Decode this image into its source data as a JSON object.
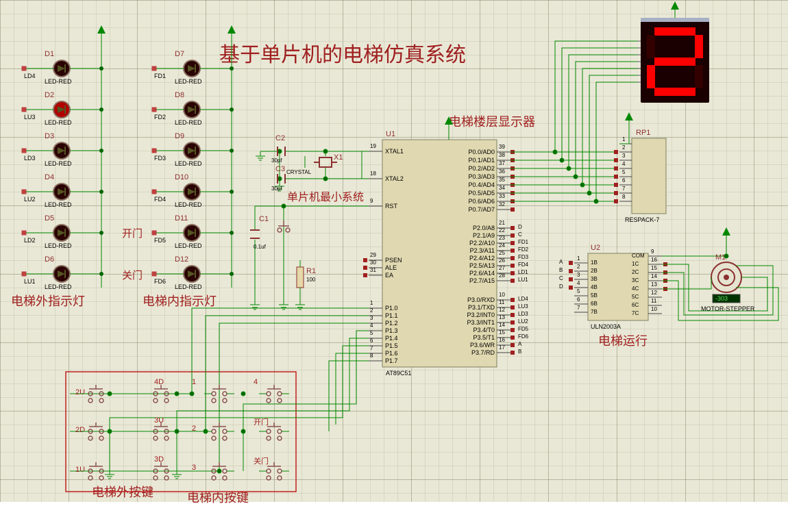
{
  "title": "基于单片机的电梯仿真系统",
  "sections": {
    "ext_leds": "电梯外指示灯",
    "int_leds": "电梯内指示灯",
    "ext_btns": "电梯外按键",
    "int_btns": "电梯内按键",
    "min_sys": "单片机最小系统",
    "floor_disp": "电梯楼层显示器",
    "motor_run": "电梯运行",
    "open": "开门",
    "close": "关门"
  },
  "leds_ext": [
    {
      "ref": "D1",
      "name": "LD4",
      "type": "LED-RED"
    },
    {
      "ref": "D2",
      "name": "LU3",
      "type": "LED-RED"
    },
    {
      "ref": "D3",
      "name": "LD3",
      "type": "LED-RED"
    },
    {
      "ref": "D4",
      "name": "LU2",
      "type": "LED-RED"
    },
    {
      "ref": "D5",
      "name": "LD2",
      "type": "LED-RED"
    },
    {
      "ref": "D6",
      "name": "LU1",
      "type": "LED-RED"
    }
  ],
  "leds_int": [
    {
      "ref": "D7",
      "name": "FD1",
      "type": "LED-RED"
    },
    {
      "ref": "D8",
      "name": "FD2",
      "type": "LED-RED"
    },
    {
      "ref": "D9",
      "name": "FD3",
      "type": "LED-RED"
    },
    {
      "ref": "D10",
      "name": "FD4",
      "type": "LED-RED"
    },
    {
      "ref": "D11",
      "name": "FD5",
      "type": "LED-RED"
    },
    {
      "ref": "D12",
      "name": "FD6",
      "type": "LED-RED"
    }
  ],
  "btn_ext": [
    {
      "label": "2U"
    },
    {
      "label": "4D"
    },
    {
      "label": "2D"
    },
    {
      "label": "3U"
    },
    {
      "label": "1U"
    },
    {
      "label": "3D"
    }
  ],
  "btn_int": [
    "1",
    "4",
    "2",
    "开门",
    "3",
    "关门"
  ],
  "parts": {
    "C1": {
      "ref": "C1",
      "val": "0.1uf"
    },
    "C2": {
      "ref": "C2",
      "val": "30pf"
    },
    "C3": {
      "ref": "C3",
      "val": "30pf"
    },
    "X1": {
      "ref": "X1",
      "val": "CRYSTAL"
    },
    "R1": {
      "ref": "R1",
      "val": "100"
    },
    "U1": {
      "ref": "U1",
      "val": "AT89C51"
    },
    "U2": {
      "ref": "U2",
      "val": "ULN2003A"
    },
    "RP1": {
      "ref": "RP1",
      "val": "RESPACK-7"
    },
    "M1": {
      "ref": "M1",
      "val": "MOTOR-STEPPER",
      "reading": "-303"
    }
  },
  "u1_pins": {
    "left": [
      {
        "n": "19",
        "t": "XTAL1"
      },
      {
        "n": "",
        "t": ""
      },
      {
        "n": "18",
        "t": "XTAL2"
      },
      {
        "n": "",
        "t": ""
      },
      {
        "n": "9",
        "t": "RST"
      },
      {
        "n": "",
        "t": ""
      },
      {
        "n": "",
        "t": ""
      },
      {
        "n": "29",
        "t": "PSEN"
      },
      {
        "n": "30",
        "t": "ALE"
      },
      {
        "n": "31",
        "t": "EA"
      },
      {
        "n": "",
        "t": ""
      },
      {
        "n": "",
        "t": ""
      },
      {
        "n": "1",
        "t": "P1.0"
      },
      {
        "n": "2",
        "t": "P1.1"
      },
      {
        "n": "3",
        "t": "P1.2"
      },
      {
        "n": "4",
        "t": "P1.3"
      },
      {
        "n": "5",
        "t": "P1.4"
      },
      {
        "n": "6",
        "t": "P1.5"
      },
      {
        "n": "7",
        "t": "P1.6"
      },
      {
        "n": "8",
        "t": "P1.7"
      }
    ],
    "right": [
      {
        "n": "39",
        "t": "P0.0/AD0"
      },
      {
        "n": "38",
        "t": "P0.1/AD1"
      },
      {
        "n": "37",
        "t": "P0.2/AD2"
      },
      {
        "n": "36",
        "t": "P0.3/AD3"
      },
      {
        "n": "35",
        "t": "P0.4/AD4"
      },
      {
        "n": "34",
        "t": "P0.5/AD5"
      },
      {
        "n": "33",
        "t": "P0.6/AD6"
      },
      {
        "n": "32",
        "t": "P0.7/AD7"
      },
      {
        "n": "",
        "t": ""
      },
      {
        "n": "21",
        "t": "P2.0/A8"
      },
      {
        "n": "22",
        "t": "P2.1/A9"
      },
      {
        "n": "23",
        "t": "P2.2/A10"
      },
      {
        "n": "24",
        "t": "P2.3/A11"
      },
      {
        "n": "25",
        "t": "P2.4/A12"
      },
      {
        "n": "26",
        "t": "P2.5/A13"
      },
      {
        "n": "27",
        "t": "P2.6/A14"
      },
      {
        "n": "28",
        "t": "P2.7/A15"
      },
      {
        "n": "",
        "t": ""
      },
      {
        "n": "10",
        "t": "P3.0/RXD"
      },
      {
        "n": "11",
        "t": "P3.1/TXD"
      },
      {
        "n": "12",
        "t": "P3.2/INT0"
      },
      {
        "n": "13",
        "t": "P3.3/INT1"
      },
      {
        "n": "14",
        "t": "P3.4/T0"
      },
      {
        "n": "15",
        "t": "P3.5/T1"
      },
      {
        "n": "16",
        "t": "P3.6/WR"
      },
      {
        "n": "17",
        "t": "P3.7/RD"
      }
    ]
  },
  "u1_right_nets": {
    "21": "D",
    "22": "C",
    "23": "FD1",
    "24": "FD2",
    "25": "FD3",
    "26": "FD4",
    "27": "LD1",
    "28": "LU1",
    "10": "LD4",
    "11": "LU3",
    "12": "LD3",
    "13": "LU2",
    "14": "FD5",
    "15": "FD6",
    "16": "A",
    "17": "B"
  },
  "u2_pins": {
    "left": [
      {
        "n": "1",
        "t": "1B"
      },
      {
        "n": "2",
        "t": "2B"
      },
      {
        "n": "3",
        "t": "3B"
      },
      {
        "n": "4",
        "t": "4B"
      },
      {
        "n": "5",
        "t": "5B"
      },
      {
        "n": "6",
        "t": "6B"
      },
      {
        "n": "7",
        "t": "7B"
      }
    ],
    "right": [
      {
        "n": "9",
        "t": "COM"
      },
      {
        "n": "16",
        "t": "1C"
      },
      {
        "n": "15",
        "t": "2C"
      },
      {
        "n": "14",
        "t": "3C"
      },
      {
        "n": "13",
        "t": "4C"
      },
      {
        "n": "12",
        "t": "5C"
      },
      {
        "n": "11",
        "t": "6C"
      },
      {
        "n": "10",
        "t": "7C"
      }
    ],
    "nets": [
      "A",
      "B",
      "C",
      "D"
    ]
  },
  "rp_pins": [
    "1",
    "2",
    "3",
    "4",
    "5",
    "6",
    "7",
    "8"
  ],
  "display_value": "2"
}
